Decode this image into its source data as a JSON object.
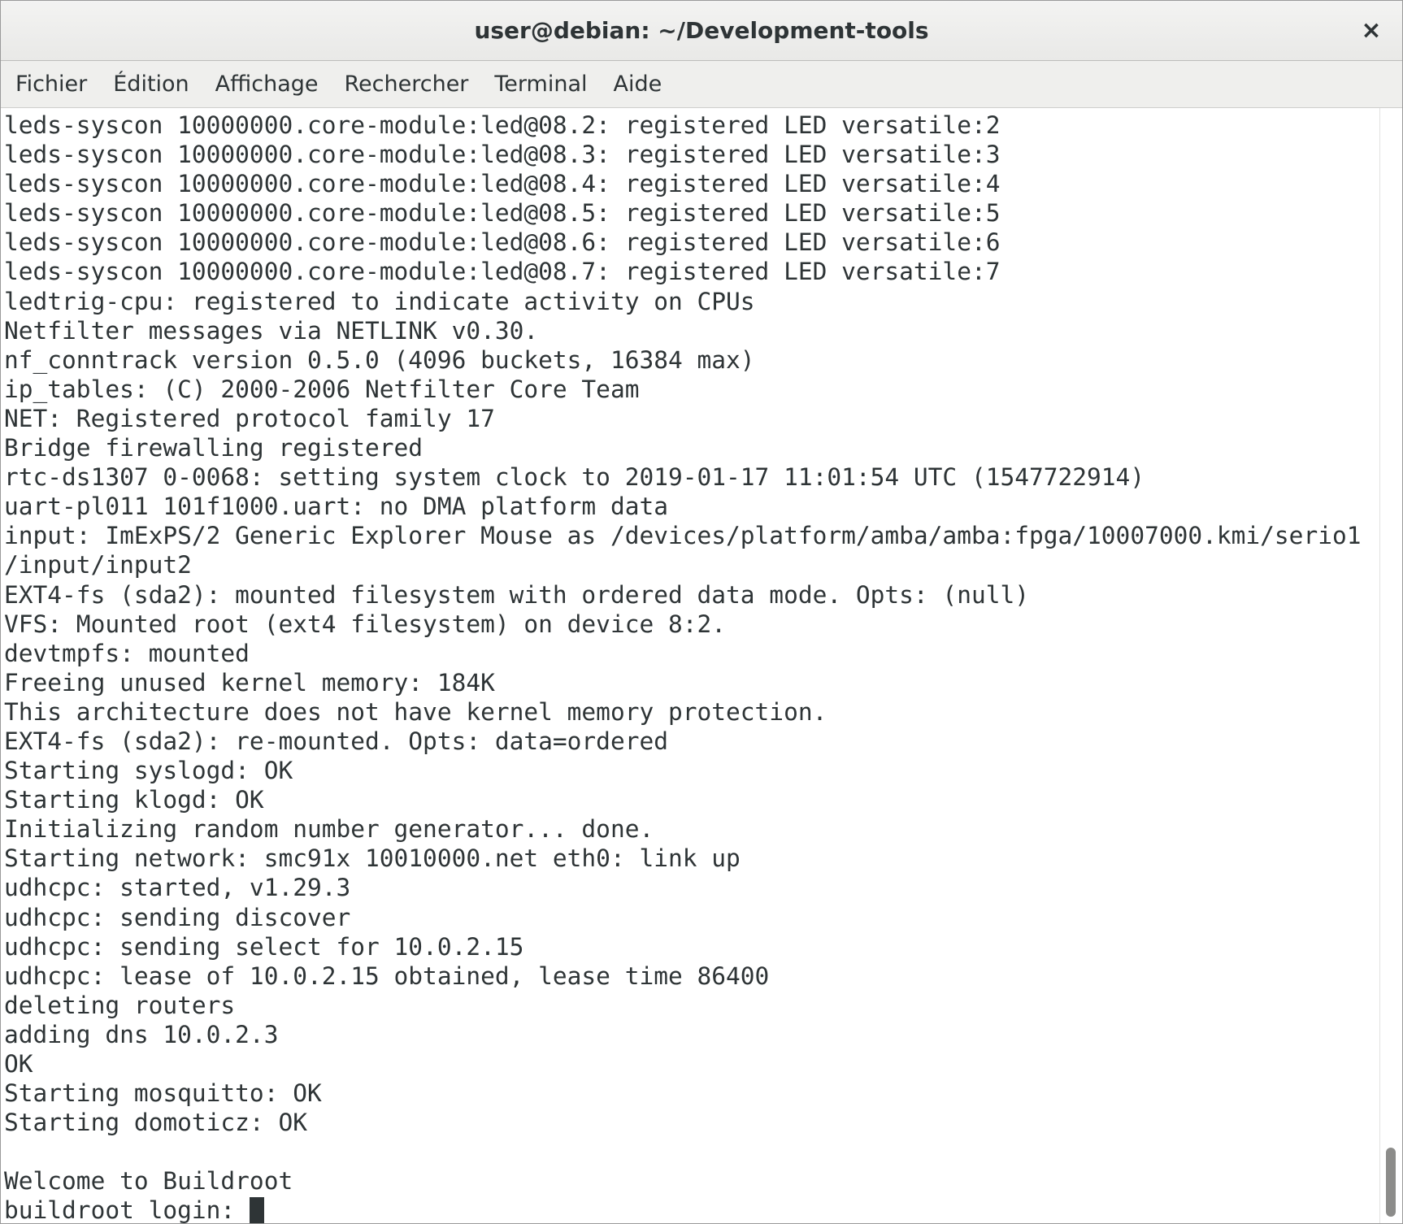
{
  "window": {
    "title": "user@debian: ~/Development-tools",
    "close_glyph": "×"
  },
  "menubar": {
    "items": [
      {
        "label": "Fichier"
      },
      {
        "label": "Édition"
      },
      {
        "label": "Affichage"
      },
      {
        "label": "Rechercher"
      },
      {
        "label": "Terminal"
      },
      {
        "label": "Aide"
      }
    ]
  },
  "terminal": {
    "lines": [
      "leds-syscon 10000000.core-module:led@08.2: registered LED versatile:2",
      "leds-syscon 10000000.core-module:led@08.3: registered LED versatile:3",
      "leds-syscon 10000000.core-module:led@08.4: registered LED versatile:4",
      "leds-syscon 10000000.core-module:led@08.5: registered LED versatile:5",
      "leds-syscon 10000000.core-module:led@08.6: registered LED versatile:6",
      "leds-syscon 10000000.core-module:led@08.7: registered LED versatile:7",
      "ledtrig-cpu: registered to indicate activity on CPUs",
      "Netfilter messages via NETLINK v0.30.",
      "nf_conntrack version 0.5.0 (4096 buckets, 16384 max)",
      "ip_tables: (C) 2000-2006 Netfilter Core Team",
      "NET: Registered protocol family 17",
      "Bridge firewalling registered",
      "rtc-ds1307 0-0068: setting system clock to 2019-01-17 11:01:54 UTC (1547722914)",
      "uart-pl011 101f1000.uart: no DMA platform data",
      "input: ImExPS/2 Generic Explorer Mouse as /devices/platform/amba/amba:fpga/10007000.kmi/serio1",
      "/input/input2",
      "EXT4-fs (sda2): mounted filesystem with ordered data mode. Opts: (null)",
      "VFS: Mounted root (ext4 filesystem) on device 8:2.",
      "devtmpfs: mounted",
      "Freeing unused kernel memory: 184K",
      "This architecture does not have kernel memory protection.",
      "EXT4-fs (sda2): re-mounted. Opts: data=ordered",
      "Starting syslogd: OK",
      "Starting klogd: OK",
      "Initializing random number generator... done.",
      "Starting network: smc91x 10010000.net eth0: link up",
      "udhcpc: started, v1.29.3",
      "udhcpc: sending discover",
      "udhcpc: sending select for 10.0.2.15",
      "udhcpc: lease of 10.0.2.15 obtained, lease time 86400",
      "deleting routers",
      "adding dns 10.0.2.3",
      "OK",
      "Starting mosquitto: OK",
      "Starting domoticz: OK",
      "",
      "Welcome to Buildroot"
    ],
    "prompt": "buildroot login: "
  },
  "colors": {
    "foreground": "#2e3436",
    "background": "#ffffff",
    "titlebar": "#efefed"
  },
  "scrollbar": {
    "position": "bottom"
  }
}
